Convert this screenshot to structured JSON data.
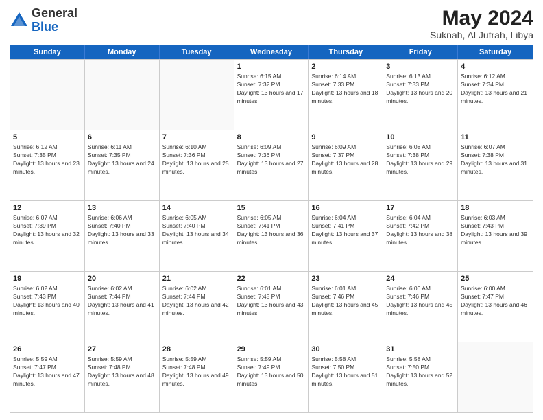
{
  "header": {
    "logo_general": "General",
    "logo_blue": "Blue",
    "month_year": "May 2024",
    "location": "Suknah, Al Jufrah, Libya"
  },
  "days_of_week": [
    "Sunday",
    "Monday",
    "Tuesday",
    "Wednesday",
    "Thursday",
    "Friday",
    "Saturday"
  ],
  "weeks": [
    [
      {
        "day": "",
        "sunrise": "",
        "sunset": "",
        "daylight": "",
        "empty": true
      },
      {
        "day": "",
        "sunrise": "",
        "sunset": "",
        "daylight": "",
        "empty": true
      },
      {
        "day": "",
        "sunrise": "",
        "sunset": "",
        "daylight": "",
        "empty": true
      },
      {
        "day": "1",
        "sunrise": "Sunrise: 6:15 AM",
        "sunset": "Sunset: 7:32 PM",
        "daylight": "Daylight: 13 hours and 17 minutes.",
        "empty": false
      },
      {
        "day": "2",
        "sunrise": "Sunrise: 6:14 AM",
        "sunset": "Sunset: 7:33 PM",
        "daylight": "Daylight: 13 hours and 18 minutes.",
        "empty": false
      },
      {
        "day": "3",
        "sunrise": "Sunrise: 6:13 AM",
        "sunset": "Sunset: 7:33 PM",
        "daylight": "Daylight: 13 hours and 20 minutes.",
        "empty": false
      },
      {
        "day": "4",
        "sunrise": "Sunrise: 6:12 AM",
        "sunset": "Sunset: 7:34 PM",
        "daylight": "Daylight: 13 hours and 21 minutes.",
        "empty": false
      }
    ],
    [
      {
        "day": "5",
        "sunrise": "Sunrise: 6:12 AM",
        "sunset": "Sunset: 7:35 PM",
        "daylight": "Daylight: 13 hours and 23 minutes.",
        "empty": false
      },
      {
        "day": "6",
        "sunrise": "Sunrise: 6:11 AM",
        "sunset": "Sunset: 7:35 PM",
        "daylight": "Daylight: 13 hours and 24 minutes.",
        "empty": false
      },
      {
        "day": "7",
        "sunrise": "Sunrise: 6:10 AM",
        "sunset": "Sunset: 7:36 PM",
        "daylight": "Daylight: 13 hours and 25 minutes.",
        "empty": false
      },
      {
        "day": "8",
        "sunrise": "Sunrise: 6:09 AM",
        "sunset": "Sunset: 7:36 PM",
        "daylight": "Daylight: 13 hours and 27 minutes.",
        "empty": false
      },
      {
        "day": "9",
        "sunrise": "Sunrise: 6:09 AM",
        "sunset": "Sunset: 7:37 PM",
        "daylight": "Daylight: 13 hours and 28 minutes.",
        "empty": false
      },
      {
        "day": "10",
        "sunrise": "Sunrise: 6:08 AM",
        "sunset": "Sunset: 7:38 PM",
        "daylight": "Daylight: 13 hours and 29 minutes.",
        "empty": false
      },
      {
        "day": "11",
        "sunrise": "Sunrise: 6:07 AM",
        "sunset": "Sunset: 7:38 PM",
        "daylight": "Daylight: 13 hours and 31 minutes.",
        "empty": false
      }
    ],
    [
      {
        "day": "12",
        "sunrise": "Sunrise: 6:07 AM",
        "sunset": "Sunset: 7:39 PM",
        "daylight": "Daylight: 13 hours and 32 minutes.",
        "empty": false
      },
      {
        "day": "13",
        "sunrise": "Sunrise: 6:06 AM",
        "sunset": "Sunset: 7:40 PM",
        "daylight": "Daylight: 13 hours and 33 minutes.",
        "empty": false
      },
      {
        "day": "14",
        "sunrise": "Sunrise: 6:05 AM",
        "sunset": "Sunset: 7:40 PM",
        "daylight": "Daylight: 13 hours and 34 minutes.",
        "empty": false
      },
      {
        "day": "15",
        "sunrise": "Sunrise: 6:05 AM",
        "sunset": "Sunset: 7:41 PM",
        "daylight": "Daylight: 13 hours and 36 minutes.",
        "empty": false
      },
      {
        "day": "16",
        "sunrise": "Sunrise: 6:04 AM",
        "sunset": "Sunset: 7:41 PM",
        "daylight": "Daylight: 13 hours and 37 minutes.",
        "empty": false
      },
      {
        "day": "17",
        "sunrise": "Sunrise: 6:04 AM",
        "sunset": "Sunset: 7:42 PM",
        "daylight": "Daylight: 13 hours and 38 minutes.",
        "empty": false
      },
      {
        "day": "18",
        "sunrise": "Sunrise: 6:03 AM",
        "sunset": "Sunset: 7:43 PM",
        "daylight": "Daylight: 13 hours and 39 minutes.",
        "empty": false
      }
    ],
    [
      {
        "day": "19",
        "sunrise": "Sunrise: 6:02 AM",
        "sunset": "Sunset: 7:43 PM",
        "daylight": "Daylight: 13 hours and 40 minutes.",
        "empty": false
      },
      {
        "day": "20",
        "sunrise": "Sunrise: 6:02 AM",
        "sunset": "Sunset: 7:44 PM",
        "daylight": "Daylight: 13 hours and 41 minutes.",
        "empty": false
      },
      {
        "day": "21",
        "sunrise": "Sunrise: 6:02 AM",
        "sunset": "Sunset: 7:44 PM",
        "daylight": "Daylight: 13 hours and 42 minutes.",
        "empty": false
      },
      {
        "day": "22",
        "sunrise": "Sunrise: 6:01 AM",
        "sunset": "Sunset: 7:45 PM",
        "daylight": "Daylight: 13 hours and 43 minutes.",
        "empty": false
      },
      {
        "day": "23",
        "sunrise": "Sunrise: 6:01 AM",
        "sunset": "Sunset: 7:46 PM",
        "daylight": "Daylight: 13 hours and 45 minutes.",
        "empty": false
      },
      {
        "day": "24",
        "sunrise": "Sunrise: 6:00 AM",
        "sunset": "Sunset: 7:46 PM",
        "daylight": "Daylight: 13 hours and 45 minutes.",
        "empty": false
      },
      {
        "day": "25",
        "sunrise": "Sunrise: 6:00 AM",
        "sunset": "Sunset: 7:47 PM",
        "daylight": "Daylight: 13 hours and 46 minutes.",
        "empty": false
      }
    ],
    [
      {
        "day": "26",
        "sunrise": "Sunrise: 5:59 AM",
        "sunset": "Sunset: 7:47 PM",
        "daylight": "Daylight: 13 hours and 47 minutes.",
        "empty": false
      },
      {
        "day": "27",
        "sunrise": "Sunrise: 5:59 AM",
        "sunset": "Sunset: 7:48 PM",
        "daylight": "Daylight: 13 hours and 48 minutes.",
        "empty": false
      },
      {
        "day": "28",
        "sunrise": "Sunrise: 5:59 AM",
        "sunset": "Sunset: 7:48 PM",
        "daylight": "Daylight: 13 hours and 49 minutes.",
        "empty": false
      },
      {
        "day": "29",
        "sunrise": "Sunrise: 5:59 AM",
        "sunset": "Sunset: 7:49 PM",
        "daylight": "Daylight: 13 hours and 50 minutes.",
        "empty": false
      },
      {
        "day": "30",
        "sunrise": "Sunrise: 5:58 AM",
        "sunset": "Sunset: 7:50 PM",
        "daylight": "Daylight: 13 hours and 51 minutes.",
        "empty": false
      },
      {
        "day": "31",
        "sunrise": "Sunrise: 5:58 AM",
        "sunset": "Sunset: 7:50 PM",
        "daylight": "Daylight: 13 hours and 52 minutes.",
        "empty": false
      },
      {
        "day": "",
        "sunrise": "",
        "sunset": "",
        "daylight": "",
        "empty": true
      }
    ]
  ]
}
